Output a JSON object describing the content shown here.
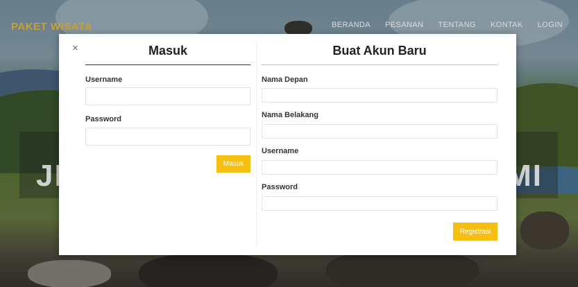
{
  "navbar": {
    "brand": "PAKET WISATA",
    "links": [
      "BERANDA",
      "PESANAN",
      "TENTANG",
      "KONTAK",
      "LOGIN"
    ]
  },
  "hero": {
    "left_text": "JI",
    "right_text": "MI"
  },
  "modal": {
    "close_icon": "×",
    "login": {
      "title": "Masuk",
      "username_label": "Username",
      "username_value": "",
      "password_label": "Password",
      "password_value": "",
      "submit_label": "Masuk"
    },
    "register": {
      "title": "Buat Akun Baru",
      "first_name_label": "Nama Depan",
      "first_name_value": "",
      "last_name_label": "Nama Belakang",
      "last_name_value": "",
      "username_label": "Username",
      "username_value": "",
      "password_label": "Password",
      "password_value": "",
      "submit_label": "Registrasi"
    }
  },
  "colors": {
    "accent": "#f6bf12",
    "brand": "#c9a12c",
    "title_rule": "#f0c52e"
  }
}
